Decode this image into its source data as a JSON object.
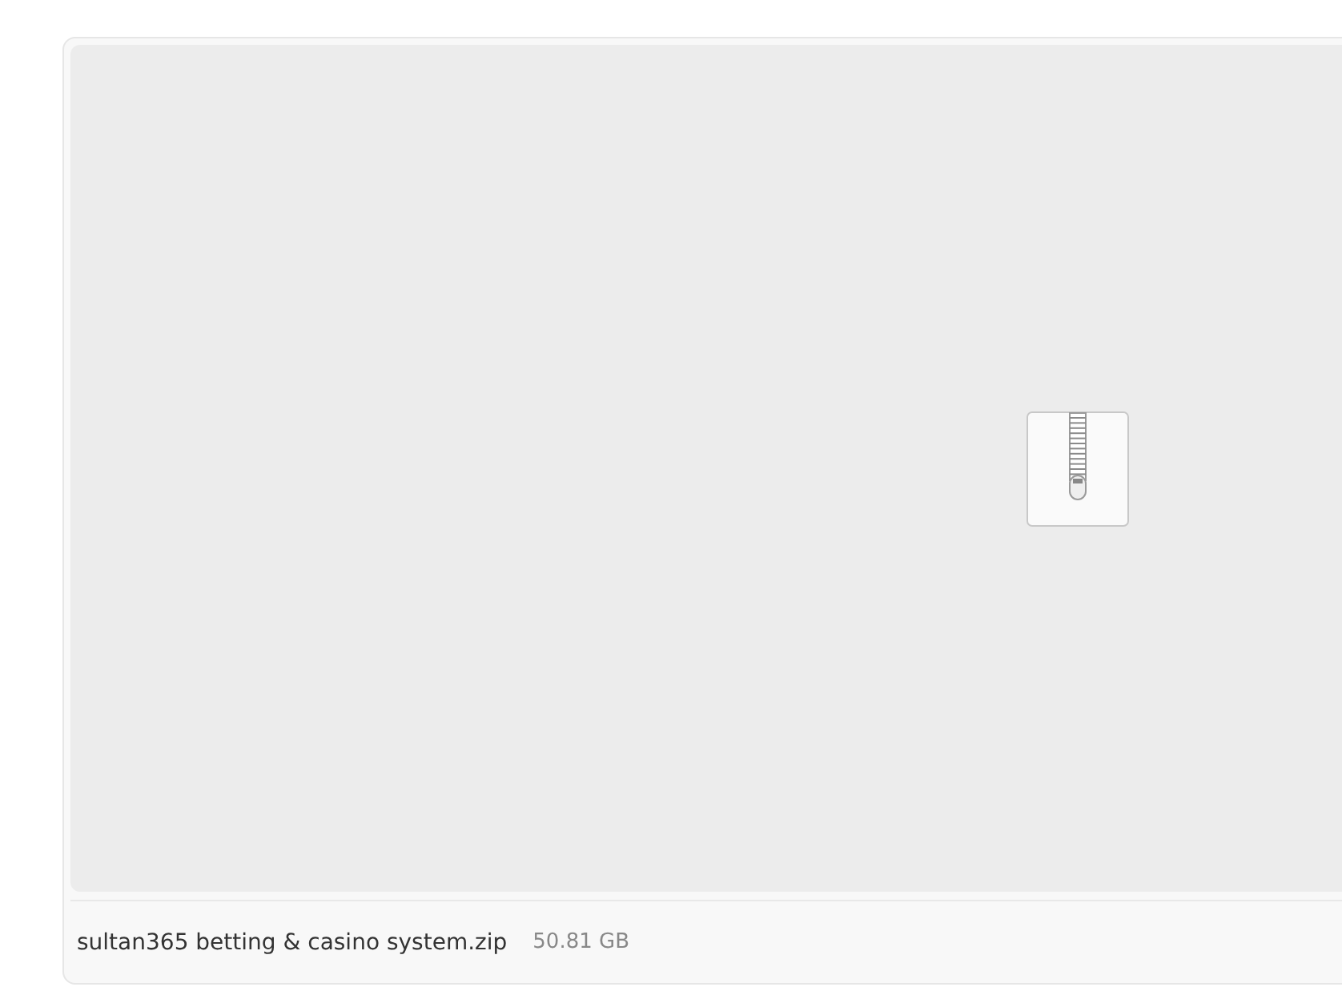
{
  "attachment": {
    "file_name": "sultan365 betting & casino system.zip",
    "file_size": "50.81 GB"
  }
}
